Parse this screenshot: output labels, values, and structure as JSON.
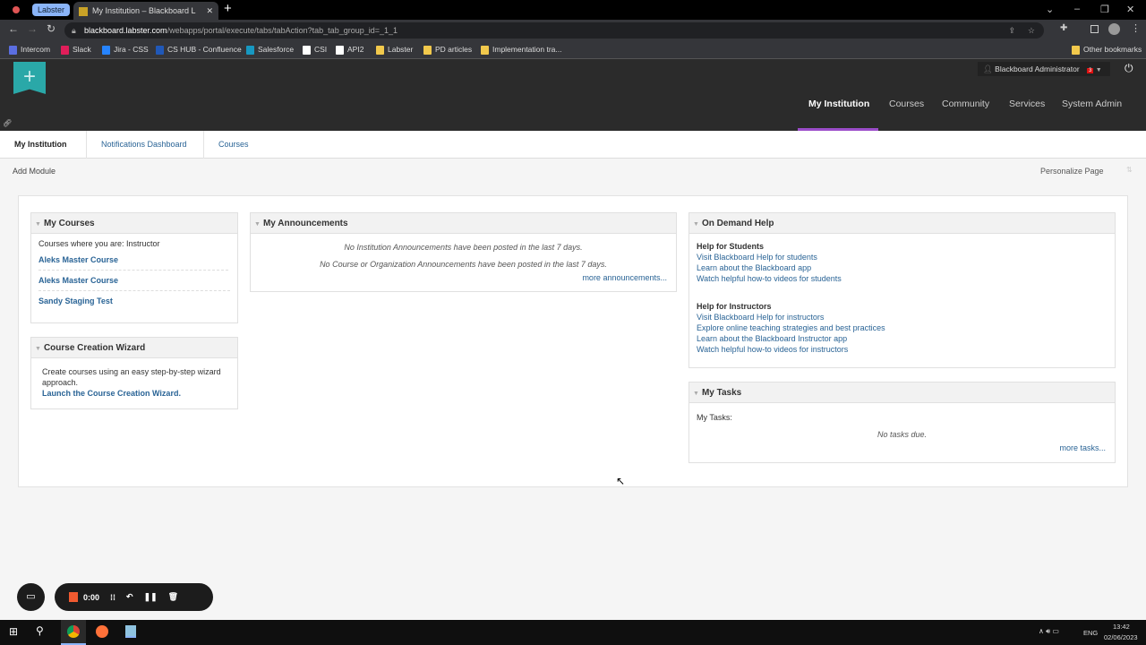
{
  "browser": {
    "group_label": "Labster",
    "tab_title": "My Institution – Blackboard L",
    "url_host": "blackboard.labster.com",
    "url_path": "/webapps/portal/execute/tabs/tabAction?tab_tab_group_id=_1_1",
    "bookmarks": [
      "Intercom",
      "Slack",
      "Jira - CSS",
      "CS HUB - Confluence",
      "Salesforce",
      "CSI",
      "API2",
      "Labster",
      "PD articles",
      "Implementation tra..."
    ],
    "other_bookmarks": "Other bookmarks"
  },
  "header": {
    "user": "Blackboard Administrator",
    "notif_count": "3",
    "nav": [
      "My Institution",
      "Courses",
      "Community",
      "Services",
      "System Admin"
    ],
    "accent": "#9b4dca"
  },
  "subtabs": [
    "My Institution",
    "Notifications Dashboard",
    "Courses"
  ],
  "toolbar": {
    "add_module": "Add Module",
    "personalize": "Personalize Page"
  },
  "my_courses": {
    "title": "My Courses",
    "role_label": "Courses where you are: Instructor",
    "courses": [
      "Aleks Master Course",
      "Aleks Master Course",
      "Sandy Staging Test"
    ]
  },
  "wizard": {
    "title": "Course Creation Wizard",
    "desc": "Create courses using an easy step-by-step wizard approach.",
    "link": "Launch the Course Creation Wizard."
  },
  "announcements": {
    "title": "My Announcements",
    "line1": "No Institution Announcements have been posted in the last 7 days.",
    "line2": "No Course or Organization Announcements have been posted in the last 7 days.",
    "more": "more announcements..."
  },
  "help": {
    "title": "On Demand Help",
    "students_heading": "Help for Students",
    "students": [
      "Visit Blackboard Help for students",
      "Learn about the Blackboard app",
      "Watch helpful how-to videos for students"
    ],
    "instructors_heading": "Help for Instructors",
    "instructors": [
      "Visit Blackboard Help for instructors",
      "Explore online teaching strategies and best practices",
      "Learn about the Blackboard Instructor app",
      "Watch helpful how-to videos for instructors"
    ]
  },
  "tasks": {
    "title": "My Tasks",
    "label": "My Tasks:",
    "empty": "No tasks due.",
    "more": "more tasks..."
  },
  "recorder": {
    "time": "0:00"
  },
  "taskbar": {
    "lang": "ENG",
    "time": "13:42",
    "date": "02/06/2023"
  }
}
